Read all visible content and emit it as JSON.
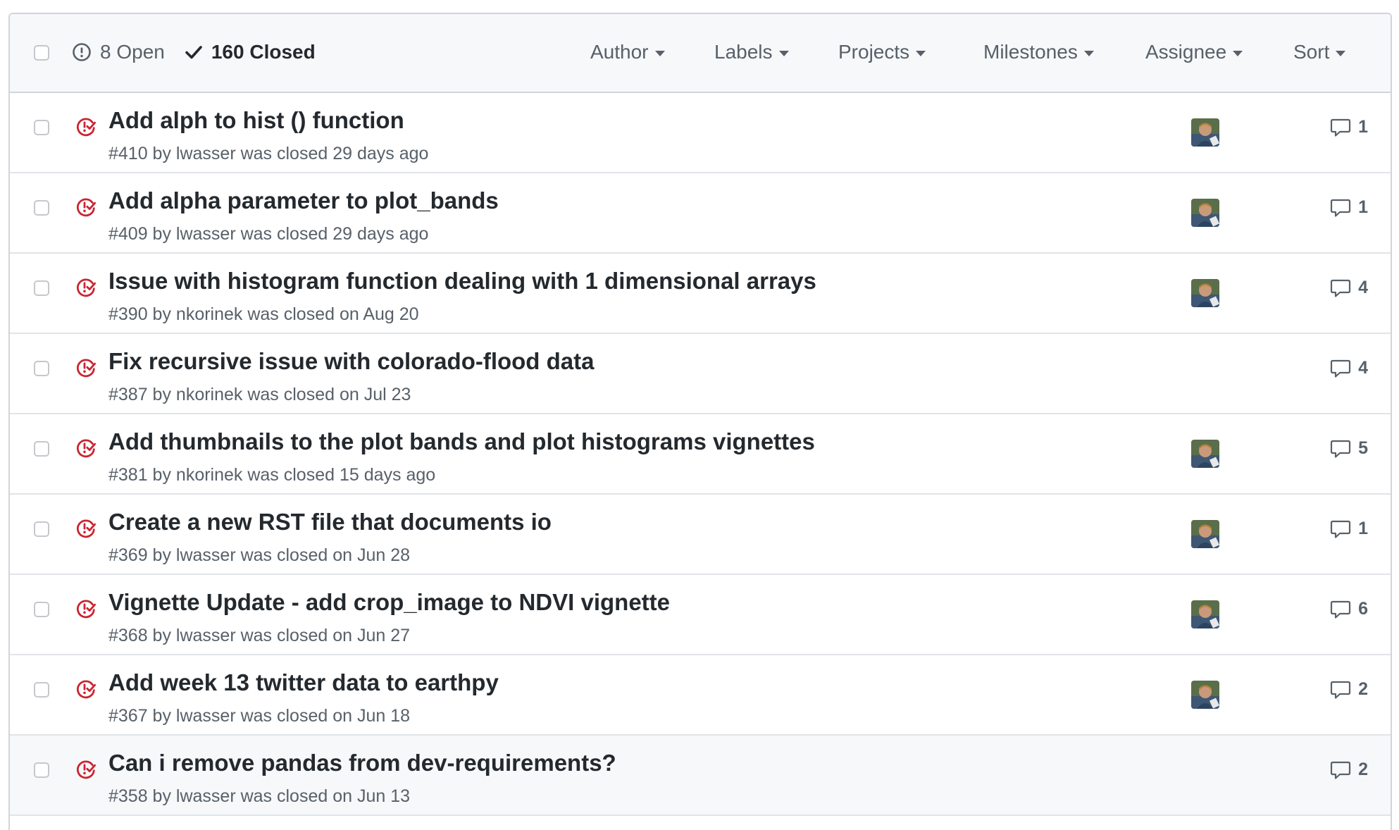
{
  "header": {
    "open_label": "8 Open",
    "closed_label": "160 Closed",
    "filters": [
      "Author",
      "Labels",
      "Projects",
      "Milestones",
      "Assignee",
      "Sort"
    ]
  },
  "colors": {
    "closed_icon": "#cb2431",
    "header_bg": "#f6f8fa",
    "border": "#d1d5da",
    "muted_text": "#586069"
  },
  "issues": [
    {
      "title": "Add alph to hist () function",
      "meta": "#410 by lwasser was closed 29 days ago",
      "comments": "1",
      "has_avatar": true
    },
    {
      "title": "Add alpha parameter to plot_bands",
      "meta": "#409 by lwasser was closed 29 days ago",
      "comments": "1",
      "has_avatar": true
    },
    {
      "title": "Issue with histogram function dealing with 1 dimensional arrays",
      "meta": "#390 by nkorinek was closed on Aug 20",
      "comments": "4",
      "has_avatar": true
    },
    {
      "title": "Fix recursive issue with colorado-flood data",
      "meta": "#387 by nkorinek was closed on Jul 23",
      "comments": "4",
      "has_avatar": false
    },
    {
      "title": "Add thumbnails to the plot bands and plot histograms vignettes",
      "meta": "#381 by nkorinek was closed 15 days ago",
      "comments": "5",
      "has_avatar": true
    },
    {
      "title": "Create a new RST file that documents io",
      "meta": "#369 by lwasser was closed on Jun 28",
      "comments": "1",
      "has_avatar": true
    },
    {
      "title": "Vignette Update - add crop_image to NDVI vignette",
      "meta": "#368 by lwasser was closed on Jun 27",
      "comments": "6",
      "has_avatar": true
    },
    {
      "title": "Add week 13 twitter data to earthpy",
      "meta": "#367 by lwasser was closed on Jun 18",
      "comments": "2",
      "has_avatar": true
    },
    {
      "title": "Can i remove pandas from dev-requirements?",
      "meta": "#358 by lwasser was closed on Jun 13",
      "comments": "2",
      "has_avatar": false
    }
  ]
}
